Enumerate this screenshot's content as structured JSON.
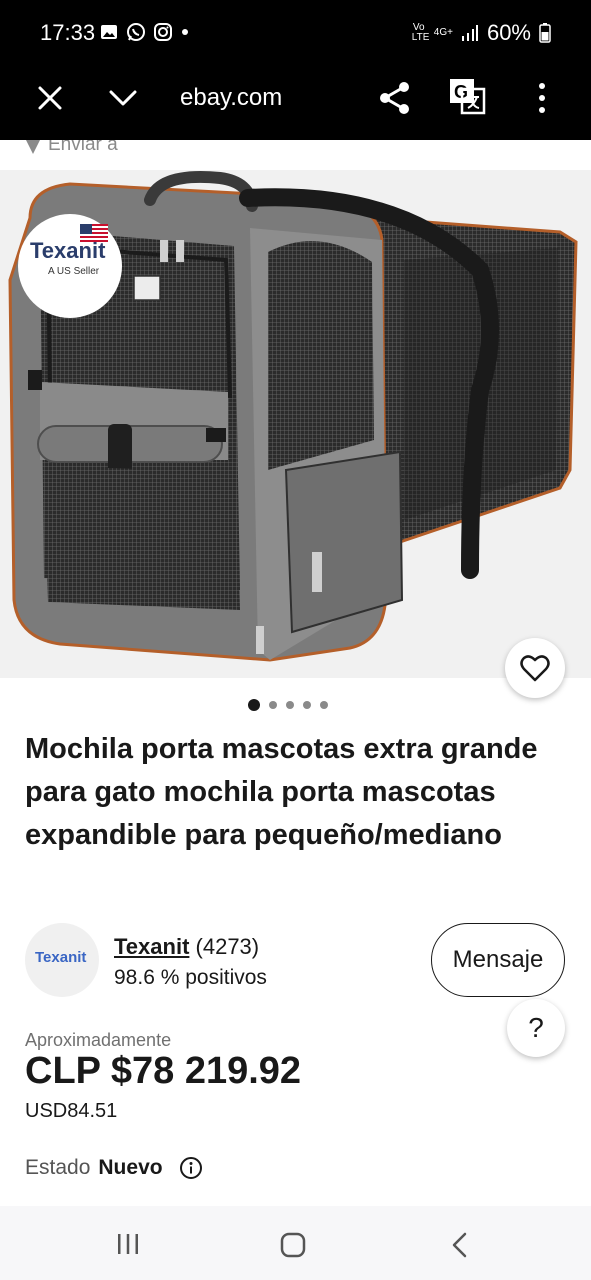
{
  "status": {
    "time": "17:33",
    "left_icons": [
      "image-icon",
      "whatsapp-icon",
      "instagram-icon",
      "dot-icon"
    ],
    "volte": "Vo LTE",
    "network": "4G+",
    "battery": "60%"
  },
  "browser": {
    "url": "ebay.com"
  },
  "ship": {
    "label": "Enviar a"
  },
  "image": {
    "badge_brand": "Texanit",
    "badge_sub": "A US Seller",
    "carousel_count": 5,
    "carousel_active": 0
  },
  "product": {
    "title": "Mochila porta mascotas extra grande para gato mochila porta mascotas expandible para pequeño/mediano"
  },
  "seller": {
    "avatar_text": "Texanit",
    "name": "Texanit",
    "count": "(4273)",
    "score": "98.6 % positivos",
    "message_label": "Mensaje"
  },
  "help": {
    "label": "?"
  },
  "price": {
    "approx_label": "Aproximadamente",
    "value": "CLP $78 219.92",
    "usd": "USD84.51"
  },
  "condition": {
    "label": "Estado",
    "value": "Nuevo"
  },
  "colors": {
    "brand_navy": "#2a3d6b",
    "text": "#191919"
  }
}
